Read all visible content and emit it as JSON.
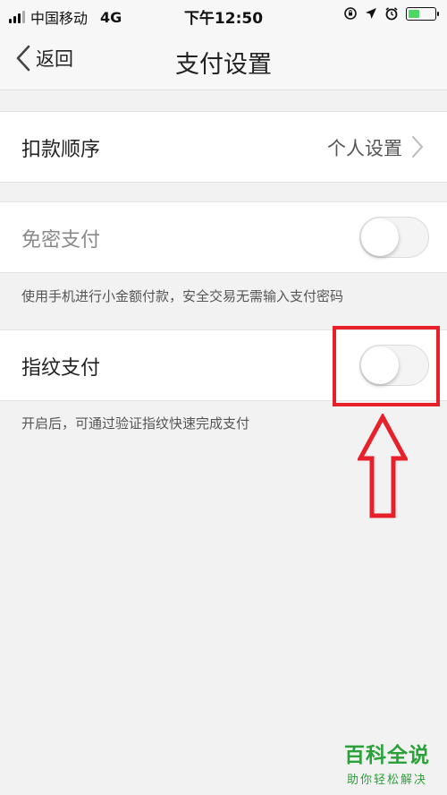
{
  "status_bar": {
    "carrier": "中国移动",
    "network": "4G",
    "time": "下午12:50"
  },
  "nav": {
    "back_label": "返回",
    "title": "支付设置"
  },
  "settings": {
    "deduction_order": {
      "label": "扣款顺序",
      "value": "个人设置"
    },
    "password_free": {
      "label": "免密支付",
      "enabled": false,
      "hint": "使用手机进行小金额付款，安全交易无需输入支付密码"
    },
    "fingerprint": {
      "label": "指纹支付",
      "enabled": false,
      "hint": "开启后，可通过验证指纹快速完成支付"
    }
  },
  "battery_level": 0.45,
  "colors": {
    "accent_red": "#e8202a",
    "battery_green": "#4cd964",
    "watermark_green": "#2aa23a"
  },
  "watermark": {
    "main": "百科全说",
    "sub": "助你轻松解决"
  }
}
